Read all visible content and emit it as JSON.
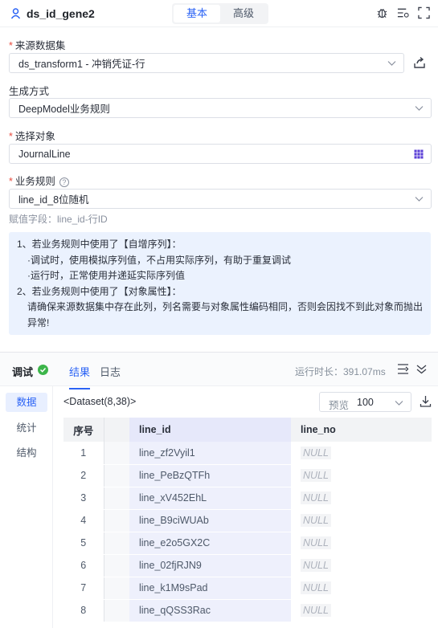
{
  "header": {
    "title": "ds_id_gene2",
    "tabs": [
      {
        "label": "基本",
        "active": true
      },
      {
        "label": "高级",
        "active": false
      }
    ]
  },
  "form": {
    "source": {
      "label": "来源数据集",
      "required": true,
      "value": "ds_transform1 - 冲销凭证-行"
    },
    "method": {
      "label": "生成方式",
      "required": false,
      "value": "DeepModel业务规则"
    },
    "object": {
      "label": "选择对象",
      "required": true,
      "value": "JournalLine"
    },
    "rule": {
      "label": "业务规则",
      "required": true,
      "value": "line_id_8位随机"
    },
    "assign_hint": "赋值字段：line_id-行ID"
  },
  "notice": {
    "lines": [
      "1、若业务规则中使用了【自增序列】：",
      "·调试时，使用模拟序列值，不占用实际序列，有助于重复调试",
      "·运行时，正常使用并递延实际序列值",
      "2、若业务规则中使用了【对象属性】：",
      "请确保来源数据集中存在此列，列名需要与对象属性编码相同，否则会因找不到此对象而抛出",
      "异常!"
    ]
  },
  "debug": {
    "title": "调试",
    "tabs": [
      {
        "label": "结果",
        "active": true
      },
      {
        "label": "日志",
        "active": false
      }
    ],
    "runtime": "运行时长：391.07ms",
    "side": [
      {
        "label": "数据",
        "active": true
      },
      {
        "label": "统计",
        "active": false
      },
      {
        "label": "结构",
        "active": false
      }
    ],
    "dataset_label": "<Dataset(8,38)>",
    "preview": {
      "label": "预览",
      "value": "100"
    },
    "table": {
      "columns": [
        "序号",
        "line_id",
        "line_no"
      ],
      "rows": [
        [
          "1",
          "line_zf2Vyil1",
          "NULL"
        ],
        [
          "2",
          "line_PeBzQTFh",
          "NULL"
        ],
        [
          "3",
          "line_xV452EhL",
          "NULL"
        ],
        [
          "4",
          "line_B9ciWUAb",
          "NULL"
        ],
        [
          "5",
          "line_e2o5GX2C",
          "NULL"
        ],
        [
          "6",
          "line_02fjRJN9",
          "NULL"
        ],
        [
          "7",
          "line_k1M9sPad",
          "NULL"
        ],
        [
          "8",
          "line_qQSS3Rac",
          "NULL"
        ]
      ]
    }
  },
  "colors": {
    "accent": "#2b63f5",
    "required": "#e84a3c",
    "success": "#3cb54a",
    "notice_bg": "#ebf2fe"
  }
}
